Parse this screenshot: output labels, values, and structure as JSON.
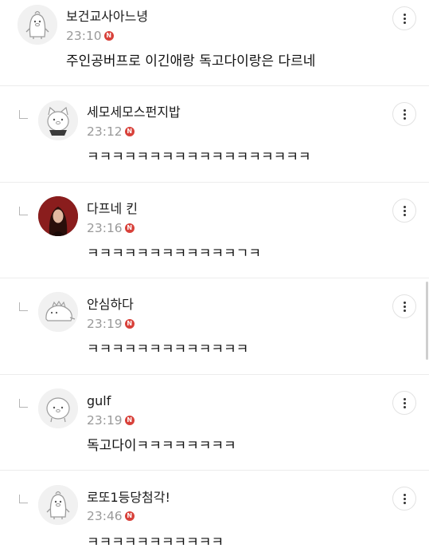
{
  "comments": [
    {
      "nickname": "보건교사아느녕",
      "time": "23:10",
      "badge": "N",
      "text": "주인공버프로 이긴애랑 독고다이랑은 다르네",
      "avatar": "penguin-avatar",
      "is_reply": false
    },
    {
      "nickname": "세모세모스펀지밥",
      "time": "23:12",
      "badge": "N",
      "text": "ㅋㅋㅋㅋㅋㅋㅋㅋㅋㅋㅋㅋㅋㅋㅋㅋㅋㅋ",
      "avatar": "cat-avatar",
      "is_reply": true
    },
    {
      "nickname": "다프네 킨",
      "time": "23:16",
      "badge": "N",
      "text": "ㅋㅋㅋㅋㅋㅋㅋㅋㅋㅋㅋㅋㄱㅋ",
      "avatar": "photo-avatar",
      "is_reply": true
    },
    {
      "nickname": "안심하다",
      "time": "23:19",
      "badge": "N",
      "text": "ㅋㅋㅋㅋㅋㅋㅋㅋㅋㅋㅋㅋㅋ",
      "avatar": "dinosaur-avatar",
      "is_reply": true
    },
    {
      "nickname": "gulf",
      "time": "23:19",
      "badge": "N",
      "text": "독고다이ㅋㅋㅋㅋㅋㅋㅋㅋ",
      "avatar": "ghost-avatar",
      "is_reply": true
    },
    {
      "nickname": "로또1등당첨각!",
      "time": "23:46",
      "badge": "N",
      "text": "ㅋㅋㅋㅋㅋㅋㅋㅋㅋㅋㅋ",
      "avatar": "penguin-avatar",
      "is_reply": true
    }
  ],
  "colors": {
    "new_badge": "#d8413a",
    "time_text": "#9a9a9a",
    "divider": "#ececec"
  }
}
